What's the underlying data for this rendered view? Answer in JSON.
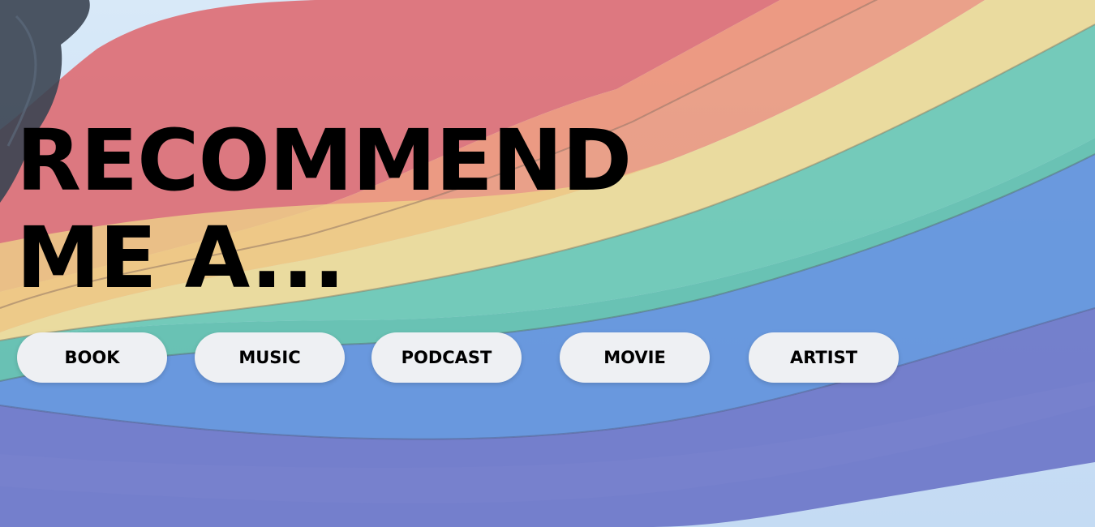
{
  "hero": {
    "headline_line1": "RECOMMEND",
    "headline_line2": "ME A...",
    "background": "rainbow-pride-flag-photo",
    "stripe_colors": [
      "#d95b63",
      "#ec8466",
      "#e9d68c",
      "#5bc1ad",
      "#4f86d8",
      "#5c68c2"
    ],
    "sky_color": "#c9def2"
  },
  "categories": {
    "book": "BOOK",
    "music": "MUSIC",
    "podcast": "PODCAST",
    "movie": "MOVIE",
    "artist": "ARTIST"
  }
}
